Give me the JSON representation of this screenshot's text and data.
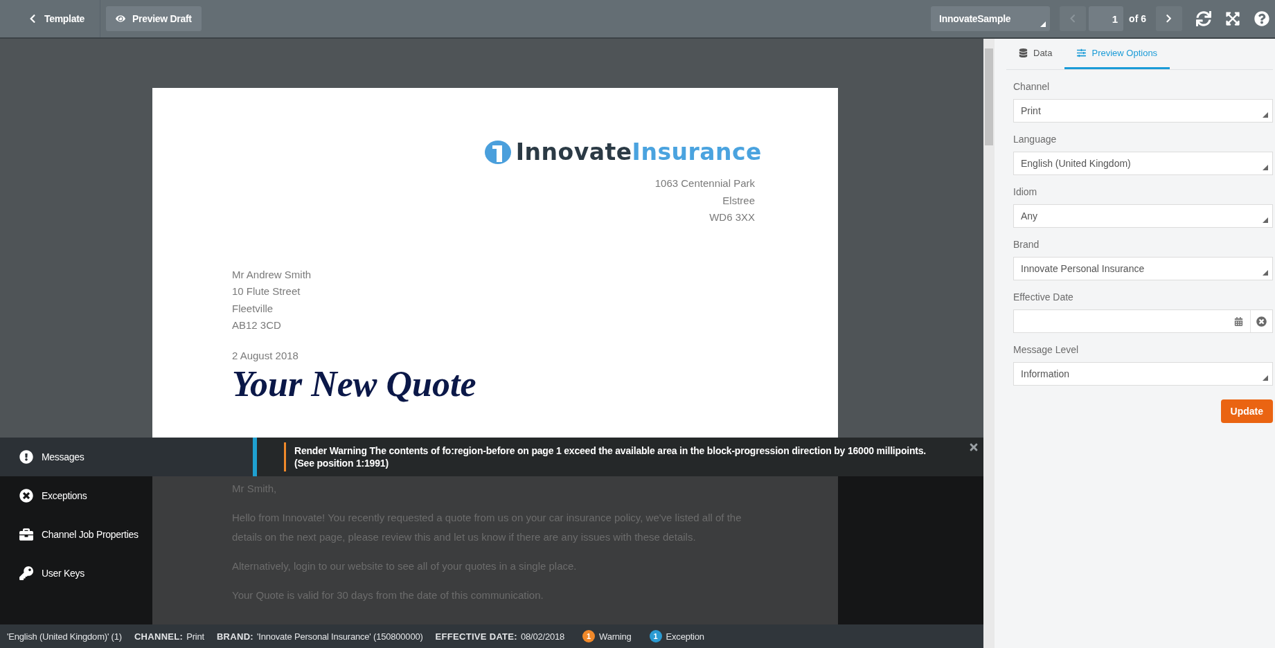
{
  "toolbar": {
    "back_button": "Template",
    "preview_button": "Preview Draft",
    "sample_select": "InnovateSample",
    "pager": {
      "prev_disabled": true,
      "page": "1",
      "total": "of 6",
      "next_disabled": false
    }
  },
  "document": {
    "logo": [
      "Innovate",
      "Insurance"
    ],
    "sender_address": [
      "1063 Centennial Park",
      "Elstree",
      "WD6 3XX"
    ],
    "recipient_address": [
      "Mr Andrew Smith",
      "10 Flute Street",
      "Fleetville",
      "AB12 3CD"
    ],
    "date": "2 August 2018",
    "heading": "Your New Quote"
  },
  "messages_panel": {
    "menu": [
      {
        "label": "Messages",
        "selected": true
      },
      {
        "label": "Exceptions",
        "selected": false
      },
      {
        "label": "Channel Job Properties",
        "selected": false
      },
      {
        "label": "User Keys",
        "selected": false
      }
    ],
    "messages": [
      {
        "kind": "warning",
        "text": "Render Warning The contents of fo:region-before on page 1 exceed the available area in the block-progression direction by 16000 millipoints. (See position 1:1991)"
      }
    ],
    "dimmed_document": [
      "Mr Smith,",
      "Hello from Innovate! You recently requested a quote from us on your car insurance policy, we've listed all of the details on the next page, please review this and let us know if there are any issues with these details.",
      "Alternatively, login to our website to see all of your quotes in a single place.",
      "Your Quote is valid for 30 days from the date of this communication."
    ]
  },
  "status_bar": {
    "items": [
      {
        "value": "'English (United Kingdom)' (1)"
      },
      {
        "label": "CHANNEL:",
        "value": "Print"
      },
      {
        "label": "BRAND:",
        "value": "'Innovate Personal Insurance' (150800000)"
      },
      {
        "label": "EFFECTIVE DATE:",
        "value": "08/02/2018"
      }
    ],
    "badges": [
      {
        "count": "1",
        "label": "Warning",
        "color": "#f0892a"
      },
      {
        "count": "1",
        "label": "Exception",
        "color": "#2b9bd3"
      }
    ]
  },
  "side_panel": {
    "tabs": [
      {
        "label": "Data",
        "selected": false
      },
      {
        "label": "Preview Options",
        "selected": true
      }
    ],
    "fields": [
      {
        "kind": "select",
        "label": "Channel",
        "value": "Print"
      },
      {
        "kind": "select",
        "label": "Language",
        "value": "English (United Kingdom)"
      },
      {
        "kind": "select",
        "label": "Idiom",
        "value": "Any"
      },
      {
        "kind": "select",
        "label": "Brand",
        "value": "Innovate Personal Insurance"
      },
      {
        "kind": "date",
        "label": "Effective Date"
      },
      {
        "kind": "select",
        "label": "Message Level",
        "value": "Information"
      }
    ],
    "update_button": "Update"
  }
}
